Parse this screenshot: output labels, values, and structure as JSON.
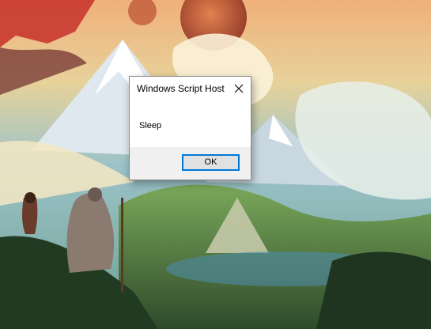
{
  "desktop": {
    "wallpaper_icon": "fantasy-landscape-wallpaper"
  },
  "dialog": {
    "title": "Windows Script Host",
    "close_icon": "close-icon",
    "message": "Sleep",
    "ok_label": "OK"
  },
  "colors": {
    "dialog_background": "#ffffff",
    "footer_background": "#f0f0f0",
    "button_border": "#0078d7",
    "button_background": "#e1e1e1"
  }
}
